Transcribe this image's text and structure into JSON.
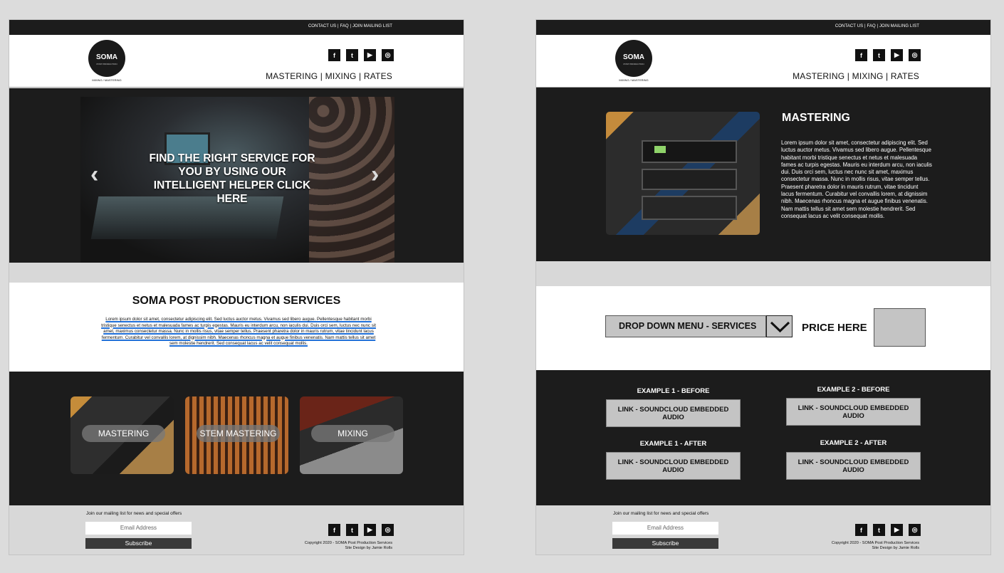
{
  "header": {
    "top_links": "CONTACT US | FAQ | JOIN MAILING LIST",
    "logo_text": "SOMA",
    "logo_subtext": "POST PRODUCTION",
    "tagline": "MIXING / MASTERING",
    "nav": "MASTERING | MIXING | RATES",
    "social": [
      {
        "icon": "facebook-icon",
        "glyph": "f"
      },
      {
        "icon": "twitter-icon",
        "glyph": "t"
      },
      {
        "icon": "youtube-icon",
        "glyph": "▶"
      },
      {
        "icon": "instagram-icon",
        "glyph": "◎"
      }
    ]
  },
  "page1": {
    "hero_text": "FIND THE RIGHT SERVICE FOR YOU BY USING OUR INTELLIGENT HELPER CLICK HERE",
    "prev_arrow": "‹",
    "next_arrow": "›",
    "services_title": "SOMA POST PRODUCTION SERVICES",
    "services_body": "Lorem ipsum dolor sit amet, consectetur adipiscing elit. Sed luctus auctor metus. Vivamus sed libero augue. Pellentesque habitant morbi tristique senectus et netus et malesuada fames ac turpis egestas. Mauris eu interdum arcu, non iaculis dui. Duis orci sem, luctus nec nunc sit amet, maximus consectetur massa. Nunc in mollis risus, vitae semper tellus. Praesent pharetra dolor in mauris rutrum, vitae tincidunt lacus fermentum. Curabitur vel convallis lorem, at dignissim nibh. Maecenas rhoncus magna et augue finibus venenatis. Nam mattis tellus sit amet sem molestie hendrerit. Sed consequat lacus ac velit consequat mollis.",
    "cards": [
      "MASTERING",
      "STEM MASTERING",
      "MIXING"
    ]
  },
  "page2": {
    "heading": "MASTERING",
    "body": "Lorem ipsum dolor sit amet, consectetur adipiscing elit. Sed luctus auctor metus. Vivamus sed libero augue. Pellentesque habitant morbi tristique senectus et netus et malesuada fames ac turpis egestas. Mauris eu interdum arcu, non iaculis dui. Duis orci sem, luctus nec nunc sit amet, maximus consectetur massa. Nunc in mollis risus, vitae semper tellus. Praesent pharetra dolor in mauris rutrum, vitae tincidunt lacus fermentum. Curabitur vel convallis lorem, at dignissim nibh. Maecenas rhoncus magna et augue finibus venenatis. Nam mattis tellus sit amet sem molestie hendrerit. Sed consequat lacus ac velit consequat mollis.",
    "dropdown_label": "DROP DOWN MENU - SERVICES",
    "price_label": "PRICE HERE",
    "examples": [
      {
        "label": "EXAMPLE 1 - BEFORE",
        "link": "LINK - SOUNDCLOUD EMBEDDED AUDIO"
      },
      {
        "label": "EXAMPLE 2 - BEFORE",
        "link": "LINK - SOUNDCLOUD EMBEDDED AUDIO"
      },
      {
        "label": "EXAMPLE 1 - AFTER",
        "link": "LINK - SOUNDCLOUD EMBEDDED AUDIO"
      },
      {
        "label": "EXAMPLE 2 - AFTER",
        "link": "LINK - SOUNDCLOUD EMBEDDED AUDIO"
      }
    ]
  },
  "footer": {
    "mailing_text": "Join our mailing list for news and special offers",
    "email_placeholder": "Email Address",
    "subscribe_label": "Subscribe",
    "copyright": "Copyright 2020 - SOMA Post Production Services",
    "credit": "Site Design by Jamie Rolls"
  }
}
